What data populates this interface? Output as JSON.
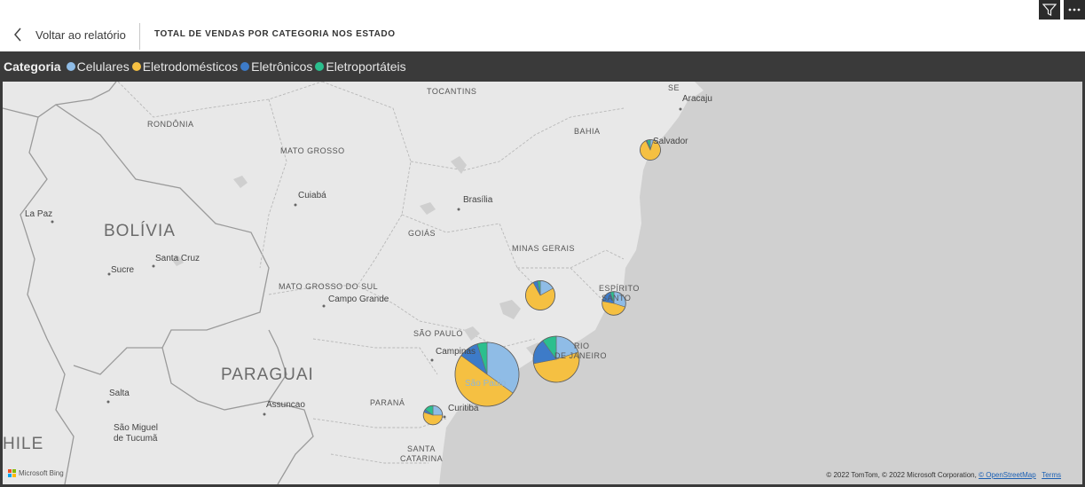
{
  "header": {
    "back_label": "Voltar ao relatório",
    "title": "TOTAL DE VENDAS POR CATEGORIA NOS ESTADO"
  },
  "icons": {
    "back": "chevron-left-icon",
    "filter": "filter-icon",
    "more": "more-options-icon"
  },
  "legend": {
    "title": "Categoria",
    "items": [
      {
        "label": "Celulares",
        "color": "#8fbce6"
      },
      {
        "label": "Eletrodomésticos",
        "color": "#f5c042"
      },
      {
        "label": "Eletrônicos",
        "color": "#3d7bc8"
      },
      {
        "label": "Eletroportáteis",
        "color": "#2bbf8e"
      }
    ]
  },
  "map": {
    "states": {
      "tocantins": "TOCANTINS",
      "se": "SE",
      "bahia": "BAHIA",
      "rondonia": "RONDÔNIA",
      "mato_grosso": "MATO GROSSO",
      "goias": "GOIÁS",
      "minas_gerais": "MINAS GERAIS",
      "mato_grosso_do_sul": "MATO GROSSO DO SUL",
      "espirito_santo_1": "ESPÍRITO",
      "espirito_santo_2": "SANTO",
      "sao_paulo": "SÃO PAULO",
      "rio_1": "RIO",
      "rio_2": "DE JANEIRO",
      "parana": "PARANÁ",
      "santa_catarina_1": "SANTA",
      "santa_catarina_2": "CATARINA"
    },
    "cities": {
      "aracaju": "Aracaju",
      "salvador": "Salvador",
      "cuiaba": "Cuiabá",
      "brasilia": "Brasília",
      "la_paz": "La Paz",
      "sucre": "Sucre",
      "santa_cruz": "Santa Cruz",
      "campo_grande": "Campo Grande",
      "campinas": "Campinas",
      "sao_paulo": "São Paulo",
      "salta": "Salta",
      "assuncao": "Assuncao",
      "curitiba": "Curitiba",
      "sao_miguel_1": "São Miguel",
      "sao_miguel_2": "de Tucumã"
    },
    "countries": {
      "bolivia": "BOLÍVIA",
      "paraguai": "PARAGUAI",
      "chile": "HILE"
    },
    "bing_label": "Microsoft Bing",
    "copyright": "© 2022 TomTom, © 2022 Microsoft Corporation,",
    "osm_link": "© OpenStreetMap",
    "terms_link": "Terms"
  },
  "chart_data": {
    "type": "pie",
    "title": "TOTAL DE VENDAS POR CATEGORIA NOS ESTADO",
    "legend_title": "Categoria",
    "categories": [
      "Celulares",
      "Eletrodomésticos",
      "Eletrônicos",
      "Eletroportáteis"
    ],
    "legend_position": "top-left",
    "pies": [
      {
        "location": "São Paulo",
        "relative_size": 1.0,
        "values": [
          0.35,
          0.5,
          0.1,
          0.05
        ]
      },
      {
        "location": "Rio de Janeiro",
        "relative_size": 0.72,
        "values": [
          0.2,
          0.52,
          0.18,
          0.1
        ]
      },
      {
        "location": "Minas Gerais",
        "relative_size": 0.46,
        "values": [
          0.17,
          0.75,
          0.05,
          0.03
        ]
      },
      {
        "location": "Espírito Santo",
        "relative_size": 0.37,
        "values": [
          0.3,
          0.48,
          0.17,
          0.05
        ]
      },
      {
        "location": "Bahia",
        "relative_size": 0.32,
        "values": [
          0.05,
          0.88,
          0.02,
          0.05
        ]
      },
      {
        "location": "Paraná",
        "relative_size": 0.3,
        "values": [
          0.25,
          0.55,
          0.05,
          0.15
        ]
      }
    ]
  }
}
